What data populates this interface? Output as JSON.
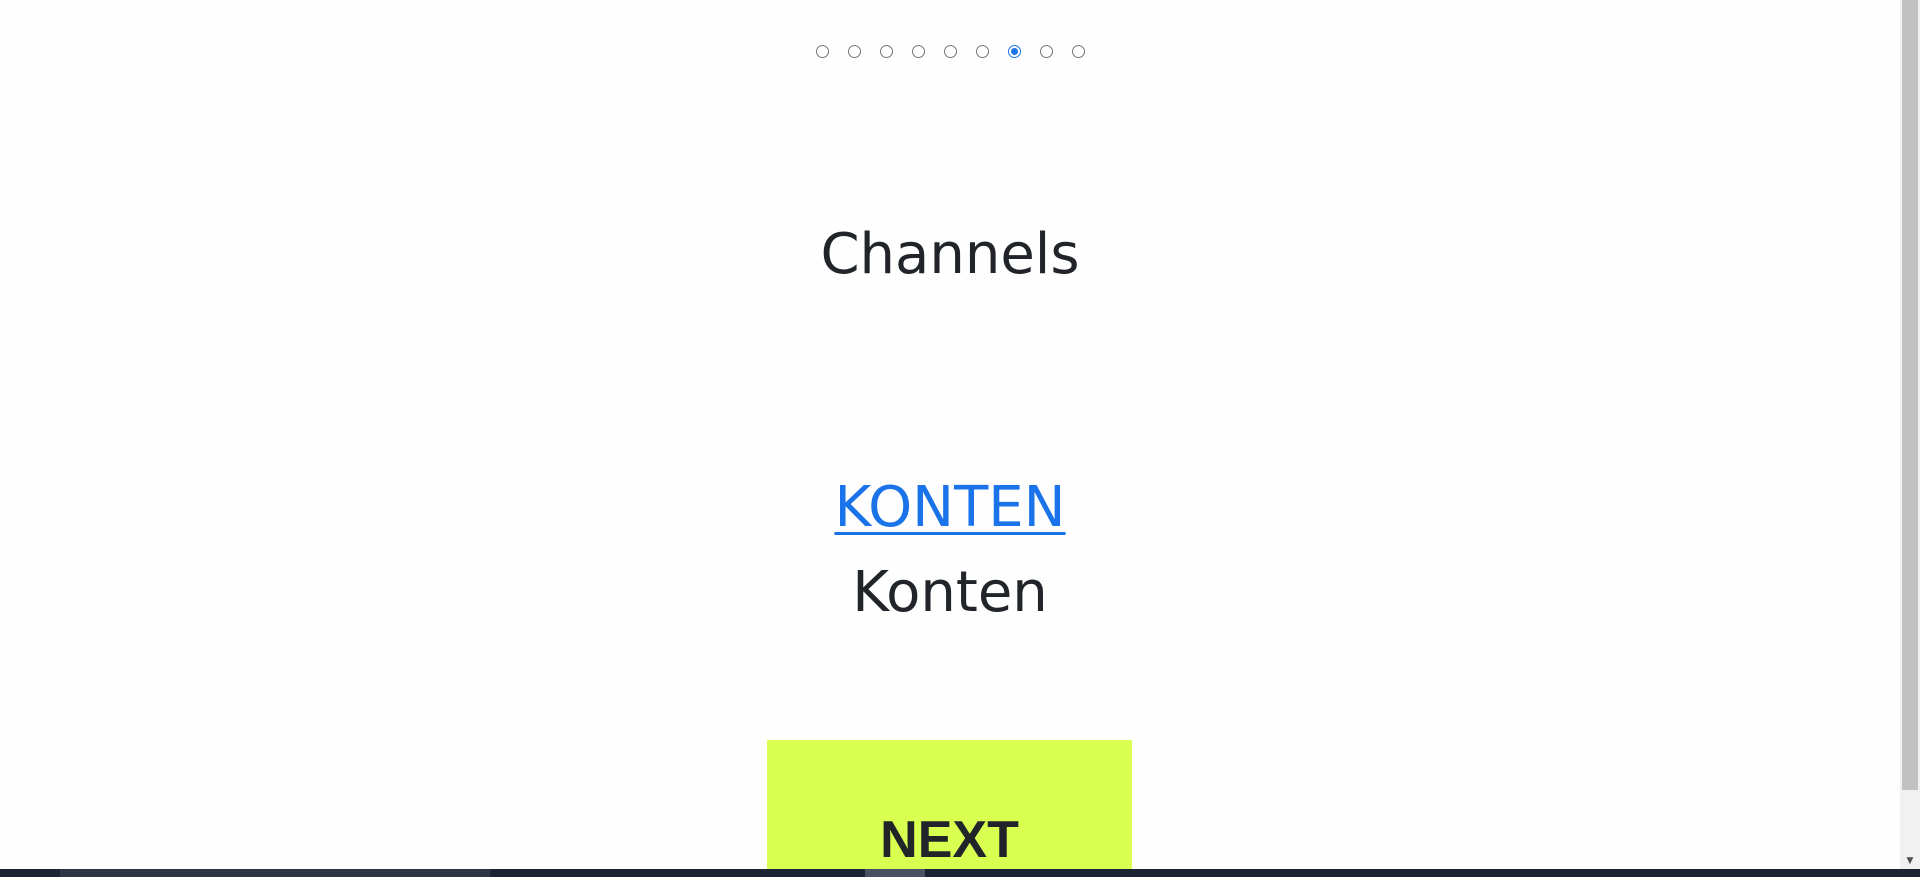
{
  "steps": {
    "count": 9,
    "active_index": 6
  },
  "main": {
    "title": "Channels",
    "link_label": "KONTEN",
    "subtitle": "Konten",
    "next_label": "NEXT"
  },
  "colors": {
    "accent": "#1a73e8",
    "button_bg": "#d9ff50",
    "text": "#212529"
  }
}
